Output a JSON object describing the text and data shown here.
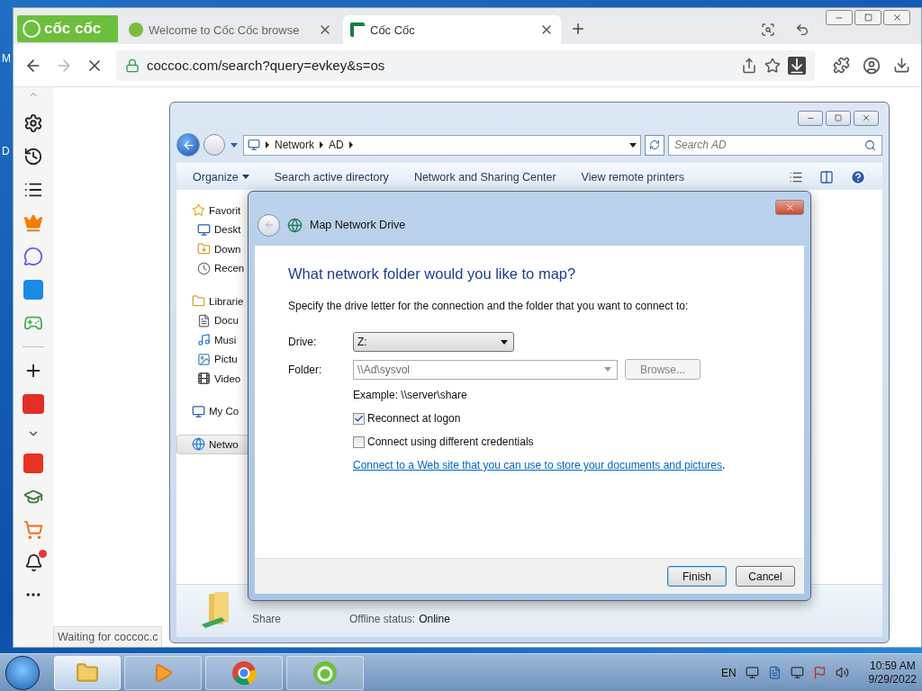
{
  "desktop_labels": [
    "M",
    "D"
  ],
  "browser": {
    "logo": "cốc cốc",
    "tabs": [
      {
        "title": "Welcome to Cốc Cốc browse",
        "selected": false
      },
      {
        "title": "Cốc Cốc",
        "selected": true
      }
    ],
    "address": "coccoc.com/search?query=evkey&s=os",
    "loading": true,
    "status": "Waiting for coccoc.c"
  },
  "explorer": {
    "breadcrumb": [
      "Network",
      "AD"
    ],
    "search_placeholder": "Search AD",
    "toolbar": [
      {
        "label": "Organize",
        "menu": true
      },
      {
        "label": "Search active directory",
        "menu": false
      },
      {
        "label": "Network and Sharing Center",
        "menu": false
      },
      {
        "label": "View remote printers",
        "menu": false
      }
    ],
    "nav": [
      {
        "label": "Favorit",
        "kind": "star",
        "selected": false,
        "children": [
          {
            "label": "Deskt",
            "kind": "desktop",
            "selected": false
          },
          {
            "label": "Down",
            "kind": "downloads",
            "selected": false
          },
          {
            "label": "Recen",
            "kind": "recent",
            "selected": false
          }
        ]
      },
      {
        "label": "Librarie",
        "kind": "library",
        "selected": false,
        "children": [
          {
            "label": "Docu",
            "kind": "document",
            "selected": false
          },
          {
            "label": "Musi",
            "kind": "music",
            "selected": false
          },
          {
            "label": "Pictu",
            "kind": "pictures",
            "selected": false
          },
          {
            "label": "Video",
            "kind": "video",
            "selected": false
          }
        ]
      },
      {
        "label": "My Co",
        "kind": "computer",
        "selected": false
      },
      {
        "label": "Netwo",
        "kind": "network",
        "selected": true
      }
    ],
    "details": {
      "type": "Share",
      "fields": [
        {
          "label": "Offline status:",
          "value": "Online"
        }
      ]
    }
  },
  "dialog": {
    "title": "Map Network Drive",
    "heading": "What network folder would you like to map?",
    "instruction": "Specify the drive letter for the connection and the folder that you want to connect to:",
    "drive": {
      "label": "Drive:",
      "value": "Z:"
    },
    "folder": {
      "label": "Folder:",
      "value": "\\\\Ad\\sysvol",
      "disabled": true
    },
    "browse": {
      "label": "Browse...",
      "disabled": true
    },
    "example": "Example: \\\\server\\share",
    "options": [
      {
        "label": "Reconnect at logon",
        "checked": true
      },
      {
        "label": "Connect using different credentials",
        "checked": false
      }
    ],
    "link": "Connect to a Web site that you can use to store your documents and pictures",
    "link_suffix": ".",
    "buttons": [
      {
        "label": "Finish",
        "default": true
      },
      {
        "label": "Cancel",
        "default": false
      }
    ]
  },
  "taskbar": {
    "apps": [
      {
        "kind": "explorer",
        "active": true
      },
      {
        "kind": "media",
        "active": false
      },
      {
        "kind": "chrome",
        "active": false
      },
      {
        "kind": "coccoc",
        "active": false
      }
    ],
    "language": "EN",
    "time": "10:59 AM",
    "date": "9/29/2022"
  }
}
